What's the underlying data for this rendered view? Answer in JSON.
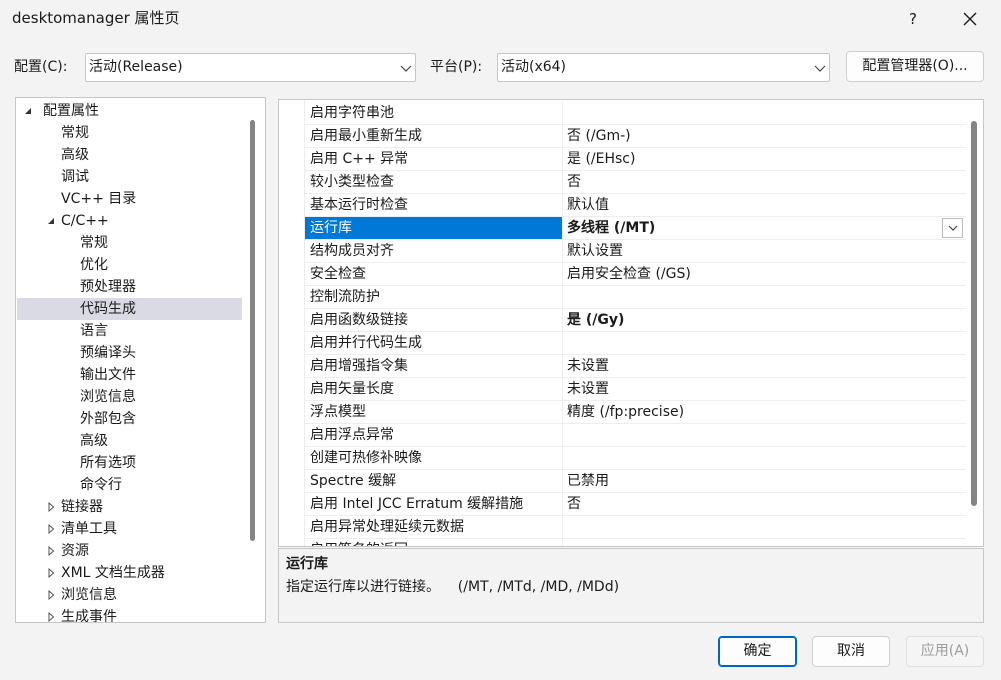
{
  "window": {
    "title": "desktomanager 属性页",
    "help_label": "?",
    "close_icon": "close-icon"
  },
  "config": {
    "config_label": "配置(C):",
    "config_value": "活动(Release)",
    "platform_label": "平台(P):",
    "platform_value": "活动(x64)",
    "manager_button": "配置管理器(O)..."
  },
  "tree": [
    {
      "label": "配置属性",
      "level": 0,
      "expander": "expanded",
      "selected": false
    },
    {
      "label": "常规",
      "level": 1,
      "expander": "none",
      "selected": false
    },
    {
      "label": "高级",
      "level": 1,
      "expander": "none",
      "selected": false
    },
    {
      "label": "调试",
      "level": 1,
      "expander": "none",
      "selected": false
    },
    {
      "label": "VC++ 目录",
      "level": 1,
      "expander": "none",
      "selected": false
    },
    {
      "label": "C/C++",
      "level": 1,
      "expander": "expanded",
      "selected": false
    },
    {
      "label": "常规",
      "level": 2,
      "expander": "none",
      "selected": false
    },
    {
      "label": "优化",
      "level": 2,
      "expander": "none",
      "selected": false
    },
    {
      "label": "预处理器",
      "level": 2,
      "expander": "none",
      "selected": false
    },
    {
      "label": "代码生成",
      "level": 2,
      "expander": "none",
      "selected": true
    },
    {
      "label": "语言",
      "level": 2,
      "expander": "none",
      "selected": false
    },
    {
      "label": "预编译头",
      "level": 2,
      "expander": "none",
      "selected": false
    },
    {
      "label": "输出文件",
      "level": 2,
      "expander": "none",
      "selected": false
    },
    {
      "label": "浏览信息",
      "level": 2,
      "expander": "none",
      "selected": false
    },
    {
      "label": "外部包含",
      "level": 2,
      "expander": "none",
      "selected": false
    },
    {
      "label": "高级",
      "level": 2,
      "expander": "none",
      "selected": false
    },
    {
      "label": "所有选项",
      "level": 2,
      "expander": "none",
      "selected": false
    },
    {
      "label": "命令行",
      "level": 2,
      "expander": "none",
      "selected": false
    },
    {
      "label": "链接器",
      "level": 1,
      "expander": "collapsed",
      "selected": false
    },
    {
      "label": "清单工具",
      "level": 1,
      "expander": "collapsed",
      "selected": false
    },
    {
      "label": "资源",
      "level": 1,
      "expander": "collapsed",
      "selected": false
    },
    {
      "label": "XML 文档生成器",
      "level": 1,
      "expander": "collapsed",
      "selected": false
    },
    {
      "label": "浏览信息",
      "level": 1,
      "expander": "collapsed",
      "selected": false
    },
    {
      "label": "生成事件",
      "level": 1,
      "expander": "collapsed",
      "selected": false
    }
  ],
  "grid": {
    "rows": [
      {
        "name": "启用字符串池",
        "value": "",
        "bold": false,
        "selected": false
      },
      {
        "name": "启用最小重新生成",
        "value": "否 (/Gm-)",
        "bold": false,
        "selected": false
      },
      {
        "name": "启用 C++ 异常",
        "value": "是 (/EHsc)",
        "bold": false,
        "selected": false
      },
      {
        "name": "较小类型检查",
        "value": "否",
        "bold": false,
        "selected": false
      },
      {
        "name": "基本运行时检查",
        "value": "默认值",
        "bold": false,
        "selected": false
      },
      {
        "name": "运行库",
        "value": "多线程 (/MT)",
        "bold": true,
        "selected": true
      },
      {
        "name": "结构成员对齐",
        "value": "默认设置",
        "bold": false,
        "selected": false
      },
      {
        "name": "安全检查",
        "value": "启用安全检查 (/GS)",
        "bold": false,
        "selected": false
      },
      {
        "name": "控制流防护",
        "value": "",
        "bold": false,
        "selected": false
      },
      {
        "name": "启用函数级链接",
        "value": "是 (/Gy)",
        "bold": true,
        "selected": false
      },
      {
        "name": "启用并行代码生成",
        "value": "",
        "bold": false,
        "selected": false
      },
      {
        "name": "启用增强指令集",
        "value": "未设置",
        "bold": false,
        "selected": false
      },
      {
        "name": "启用矢量长度",
        "value": "未设置",
        "bold": false,
        "selected": false
      },
      {
        "name": "浮点模型",
        "value": "精度 (/fp:precise)",
        "bold": false,
        "selected": false
      },
      {
        "name": "启用浮点异常",
        "value": "",
        "bold": false,
        "selected": false
      },
      {
        "name": "创建可热修补映像",
        "value": "",
        "bold": false,
        "selected": false
      },
      {
        "name": "Spectre 缓解",
        "value": "已禁用",
        "bold": false,
        "selected": false
      },
      {
        "name": "启用 Intel JCC Erratum 缓解措施",
        "value": "否",
        "bold": false,
        "selected": false
      },
      {
        "name": "启用异常处理延续元数据",
        "value": "",
        "bold": false,
        "selected": false
      },
      {
        "name": "启用签名的返回",
        "value": "",
        "bold": false,
        "selected": false
      }
    ]
  },
  "description": {
    "title": "运行库",
    "text": "指定运行库以进行链接。    (/MT, /MTd, /MD, /MDd)"
  },
  "buttons": {
    "ok": "确定",
    "cancel": "取消",
    "apply": "应用(A)",
    "apply_enabled": false
  },
  "colors": {
    "selection_blue": "#0078d7",
    "tree_selection": "#dadae5",
    "default_button_border": "#0067c0"
  }
}
